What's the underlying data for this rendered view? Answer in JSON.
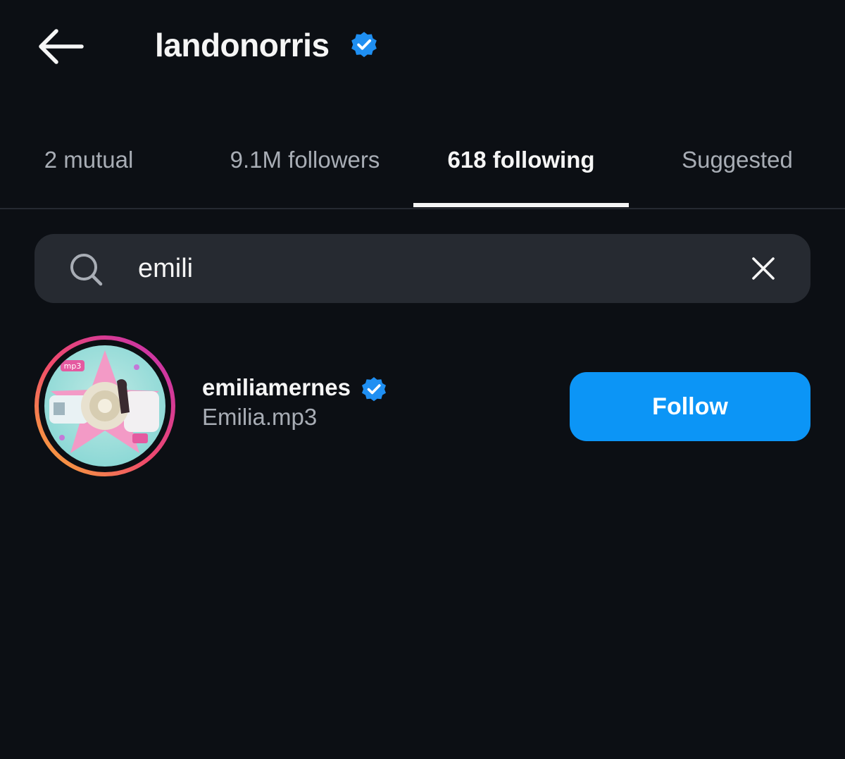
{
  "header": {
    "title": "landonorris",
    "verified": true,
    "back_icon": "arrow-left-icon",
    "badge_icon": "verified-badge-icon"
  },
  "tabs": [
    {
      "label": "2 mutual",
      "active": false
    },
    {
      "label": "9.1M followers",
      "active": false
    },
    {
      "label": "618 following",
      "active": true
    },
    {
      "label": "Suggested",
      "active": false
    }
  ],
  "search": {
    "value": "emili",
    "search_icon": "search-icon",
    "clear_icon": "close-icon"
  },
  "results": [
    {
      "username": "emiliamernes",
      "full_name": "Emilia.mp3",
      "verified": true,
      "has_story": true,
      "avatar_text": "mp3",
      "action_label": "Follow"
    }
  ],
  "colors": {
    "background": "#0c0f14",
    "primary_text": "#f5f5f5",
    "secondary_text": "#a8adb5",
    "search_background": "#262a31",
    "follow_button": "#0c95f6",
    "verified_badge": "#1f8ff2"
  }
}
